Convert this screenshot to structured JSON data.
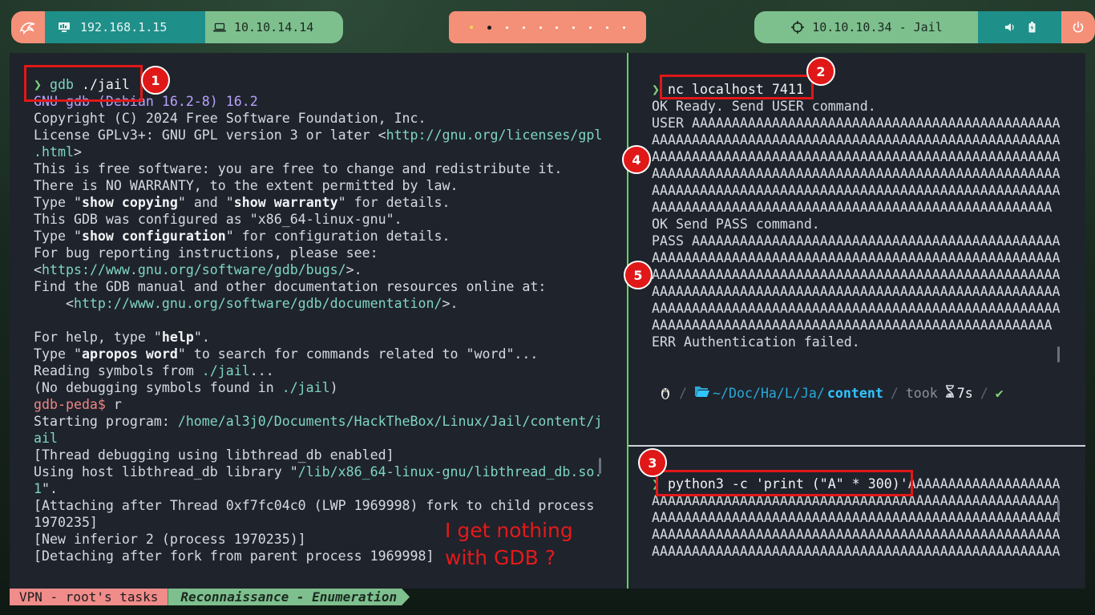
{
  "topbar": {
    "host_ip": "192.168.1.15",
    "vpn_ip": "10.10.14.14",
    "target": "10.10.10.34 - Jail",
    "workspaces": [
      "active",
      "current",
      "empty",
      "empty",
      "empty",
      "empty",
      "empty",
      "empty",
      "empty",
      "empty"
    ],
    "icons": {
      "launcher": "kali-dragon-icon",
      "host": "monitor-icon",
      "vpn": "laptop-icon",
      "target": "crosshair-icon",
      "volume": "volume-icon",
      "battery": "battery-icon",
      "power": "power-icon"
    },
    "colors": {
      "salmon": "#f59078",
      "teal": "#1f8f8a",
      "green": "#7ebf8e"
    }
  },
  "left_pane": {
    "lines": [
      [
        {
          "t": "❯ ",
          "c": "g"
        },
        {
          "t": "gdb ",
          "c": "teal"
        },
        {
          "t": "./jail",
          "c": "white"
        }
      ],
      [
        {
          "t": "GNU gdb (Debian 16.2-8) 16.2",
          "c": "violet"
        }
      ],
      [
        {
          "t": "Copyright (C) 2024 Free Software Foundation, Inc."
        }
      ],
      [
        {
          "t": "License GPLv3+: GNU GPL version 3 or later <"
        },
        {
          "t": "http://gnu.org/licenses/gpl",
          "c": "teal"
        }
      ],
      [
        {
          "t": ".html",
          "c": "teal"
        },
        {
          "t": ">"
        }
      ],
      [
        {
          "t": "This is free software: you are free to change and redistribute it."
        }
      ],
      [
        {
          "t": "There is NO WARRANTY, to the extent permitted by law."
        }
      ],
      [
        {
          "t": "Type \""
        },
        {
          "t": "show copying",
          "c": "bold"
        },
        {
          "t": "\" and \""
        },
        {
          "t": "show warranty",
          "c": "bold"
        },
        {
          "t": "\" for details."
        }
      ],
      [
        {
          "t": "This GDB was configured as \"x86_64-linux-gnu\"."
        }
      ],
      [
        {
          "t": "Type \""
        },
        {
          "t": "show configuration",
          "c": "bold"
        },
        {
          "t": "\" for configuration details."
        }
      ],
      [
        {
          "t": "For bug reporting instructions, please see:"
        }
      ],
      [
        {
          "t": "<"
        },
        {
          "t": "https://www.gnu.org/software/gdb/bugs/",
          "c": "teal"
        },
        {
          "t": ">."
        }
      ],
      [
        {
          "t": "Find the GDB manual and other documentation resources online at:"
        }
      ],
      [
        {
          "t": "    <"
        },
        {
          "t": "http://www.gnu.org/software/gdb/documentation/",
          "c": "teal"
        },
        {
          "t": ">."
        }
      ],
      [
        {
          "t": ""
        }
      ],
      [
        {
          "t": "For help, type \""
        },
        {
          "t": "help",
          "c": "bold"
        },
        {
          "t": "\"."
        }
      ],
      [
        {
          "t": "Type \""
        },
        {
          "t": "apropos word",
          "c": "bold"
        },
        {
          "t": "\" to search for commands related to \"word\"..."
        }
      ],
      [
        {
          "t": "Reading symbols from "
        },
        {
          "t": "./jail",
          "c": "teal"
        },
        {
          "t": "..."
        }
      ],
      [
        {
          "t": "(No debugging symbols found in "
        },
        {
          "t": "./jail",
          "c": "teal"
        },
        {
          "t": ")"
        }
      ],
      [
        {
          "t": "gdb-peda$ ",
          "c": "red"
        },
        {
          "t": "r"
        }
      ],
      [
        {
          "t": "Starting program: "
        },
        {
          "t": "/home/al3j0/Documents/HackTheBox/Linux/Jail/content/j",
          "c": "teal"
        }
      ],
      [
        {
          "t": "ail",
          "c": "teal"
        }
      ],
      [
        {
          "t": "[Thread debugging using libthread_db enabled]"
        }
      ],
      [
        {
          "t": "Using host libthread_db library \""
        },
        {
          "t": "/lib/x86_64-linux-gnu/libthread_db.so.",
          "c": "teal"
        }
      ],
      [
        {
          "t": "1",
          "c": "teal"
        },
        {
          "t": "\"."
        }
      ],
      [
        {
          "t": "[Attaching after Thread 0xf7fc04c0 (LWP 1969998) fork to child process"
        }
      ],
      [
        {
          "t": "1970235]"
        }
      ],
      [
        {
          "t": "[New inferior 2 (process 1970235)]"
        }
      ],
      [
        {
          "t": "[Detaching after fork from parent process 1969998]"
        }
      ]
    ]
  },
  "right_top": {
    "lines": [
      [
        {
          "t": "❯ ",
          "c": "g"
        },
        {
          "t": "nc localhost 7411",
          "c": "white"
        }
      ],
      [
        {
          "t": "OK Ready. Send USER command."
        }
      ],
      [
        {
          "t": "USER AAAAAAAAAAAAAAAAAAAAAAAAAAAAAAAAAAAAAAAAAAAAAA"
        }
      ],
      [
        {
          "t": "AAAAAAAAAAAAAAAAAAAAAAAAAAAAAAAAAAAAAAAAAAAAAAAAAAA"
        }
      ],
      [
        {
          "t": "AAAAAAAAAAAAAAAAAAAAAAAAAAAAAAAAAAAAAAAAAAAAAAAAAAA"
        }
      ],
      [
        {
          "t": "AAAAAAAAAAAAAAAAAAAAAAAAAAAAAAAAAAAAAAAAAAAAAAAAAAA"
        }
      ],
      [
        {
          "t": "AAAAAAAAAAAAAAAAAAAAAAAAAAAAAAAAAAAAAAAAAAAAAAAAAAA"
        }
      ],
      [
        {
          "t": "AAAAAAAAAAAAAAAAAAAAAAAAAAAAAAAAAAAAAAAAAAAAAAAAAA"
        }
      ],
      [
        {
          "t": "OK Send PASS command."
        }
      ],
      [
        {
          "t": "PASS AAAAAAAAAAAAAAAAAAAAAAAAAAAAAAAAAAAAAAAAAAAAAA"
        }
      ],
      [
        {
          "t": "AAAAAAAAAAAAAAAAAAAAAAAAAAAAAAAAAAAAAAAAAAAAAAAAAAA"
        }
      ],
      [
        {
          "t": "AAAAAAAAAAAAAAAAAAAAAAAAAAAAAAAAAAAAAAAAAAAAAAAAAAA"
        }
      ],
      [
        {
          "t": "AAAAAAAAAAAAAAAAAAAAAAAAAAAAAAAAAAAAAAAAAAAAAAAAAAA"
        }
      ],
      [
        {
          "t": "AAAAAAAAAAAAAAAAAAAAAAAAAAAAAAAAAAAAAAAAAAAAAAAAAAA"
        }
      ],
      [
        {
          "t": "AAAAAAAAAAAAAAAAAAAAAAAAAAAAAAAAAAAAAAAAAAAAAAAAAA"
        }
      ],
      [
        {
          "t": "ERR Authentication failed."
        }
      ]
    ]
  },
  "prompt": {
    "os_icon": "linux-penguin-icon",
    "folder_icon": "folder-open-icon",
    "path_prefix": "~/Doc/Ha/L/Ja/",
    "path_current": "content",
    "took_label": "took",
    "timer_icon": "hourglass-icon",
    "duration": "7s",
    "status": "✔"
  },
  "right_bottom": {
    "lines": [
      [
        {
          "t": "❯ ",
          "c": "g"
        },
        {
          "t": "python3 -c 'print (\"A\" * 300)'",
          "c": "white"
        },
        {
          "t": "AAAAAAAAAAAAAAAAAAA"
        }
      ],
      [
        {
          "t": "AAAAAAAAAAAAAAAAAAAAAAAAAAAAAAAAAAAAAAAAAAAAAAAAAAA"
        }
      ],
      [
        {
          "t": "AAAAAAAAAAAAAAAAAAAAAAAAAAAAAAAAAAAAAAAAAAAAAAAAAAA"
        }
      ],
      [
        {
          "t": "AAAAAAAAAAAAAAAAAAAAAAAAAAAAAAAAAAAAAAAAAAAAAAAAAAA"
        }
      ],
      [
        {
          "t": "AAAAAAAAAAAAAAAAAAAAAAAAAAAAAAAAAAAAAAAAAAAAAAAAAAA"
        }
      ]
    ]
  },
  "annotations": {
    "badges": [
      "1",
      "2",
      "3",
      "4",
      "5"
    ],
    "note": "I get nothing\nwith GDB ?",
    "color": "#e01818"
  },
  "statusbar": {
    "session": "VPN - root's tasks",
    "window": "Reconnaissance - Enumeration"
  }
}
